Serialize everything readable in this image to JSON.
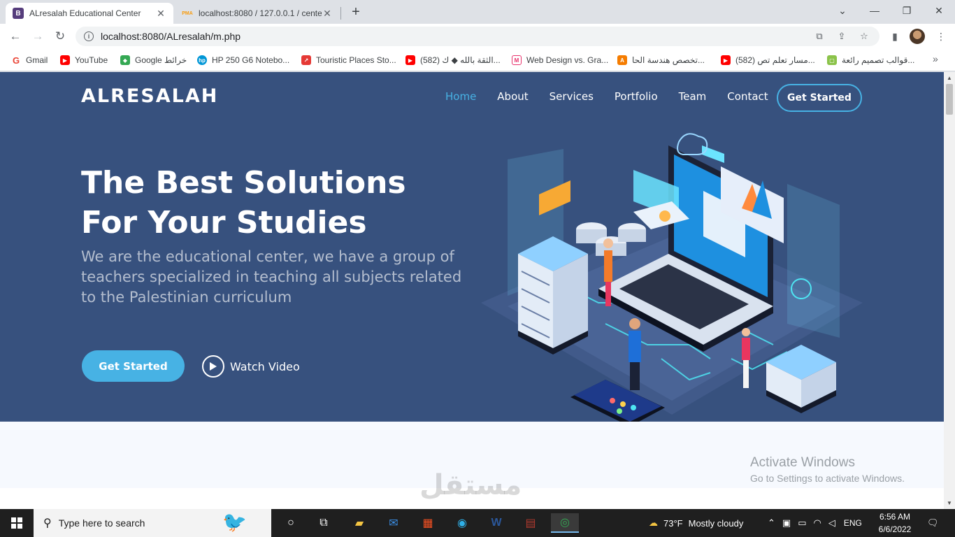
{
  "browser": {
    "tabs": [
      {
        "title": "ALresalah Educational Center",
        "favicon": "B",
        "favicon_color": "#563d7c",
        "active": true
      },
      {
        "title": "localhost:8080 / 127.0.0.1 / cente",
        "favicon": "PMA",
        "favicon_color": "#f89c0e",
        "active": false
      }
    ],
    "new_tab_symbol": "+",
    "url": "localhost:8080/ALresalah/m.php",
    "bookmarks": [
      {
        "label": "Gmail",
        "icon": "gmail-icon",
        "color": "#ea4335"
      },
      {
        "label": "YouTube",
        "icon": "youtube-icon",
        "color": "#ff0000"
      },
      {
        "label": "Google خرائط",
        "icon": "maps-icon",
        "color": "#34a853"
      },
      {
        "label": "HP 250 G6 Notebo...",
        "icon": "hp-icon",
        "color": "#0096d6"
      },
      {
        "label": "Touristic Places Sto...",
        "icon": "page-icon",
        "color": "#e53935"
      },
      {
        "label": "(582) الثقة بالله ◆ ك...",
        "icon": "youtube-icon",
        "color": "#ff0000"
      },
      {
        "label": "Web Design vs. Gra...",
        "icon": "mail-icon",
        "color": "#e8336d"
      },
      {
        "label": "تخصص هندسة الحا...",
        "icon": "site-icon",
        "color": "#f57c00"
      },
      {
        "label": "(582) مسار تعلم تص...",
        "icon": "youtube-icon",
        "color": "#ff0000"
      },
      {
        "label": "قوالب تصميم رائعة...",
        "icon": "template-icon",
        "color": "#8bc34a"
      }
    ]
  },
  "site": {
    "logo": "ALRESALAH",
    "nav": [
      {
        "label": "Home",
        "active": true
      },
      {
        "label": "About",
        "active": false
      },
      {
        "label": "Services",
        "active": false
      },
      {
        "label": "Portfolio",
        "active": false
      },
      {
        "label": "Team",
        "active": false
      },
      {
        "label": "Contact",
        "active": false
      }
    ],
    "nav_cta": "Get Started",
    "hero": {
      "title": "The Best Solutions For Your Studies",
      "subtitle": "We are the educational center, we have a group of teachers specialized in teaching all subjects related to the Palestinian curriculum",
      "primary_button": "Get Started",
      "video_button": "Watch Video"
    },
    "colors": {
      "hero_bg": "#37517e",
      "accent": "#47b2e4"
    }
  },
  "overlay": {
    "activate_title": "Activate Windows",
    "activate_sub": "Go to Settings to activate Windows.",
    "watermark": "مستقل"
  },
  "taskbar": {
    "search_placeholder": "Type here to search",
    "weather_temp": "73°F",
    "weather_text": "Mostly cloudy",
    "language": "ENG",
    "time": "6:56 AM",
    "date": "6/6/2022"
  }
}
